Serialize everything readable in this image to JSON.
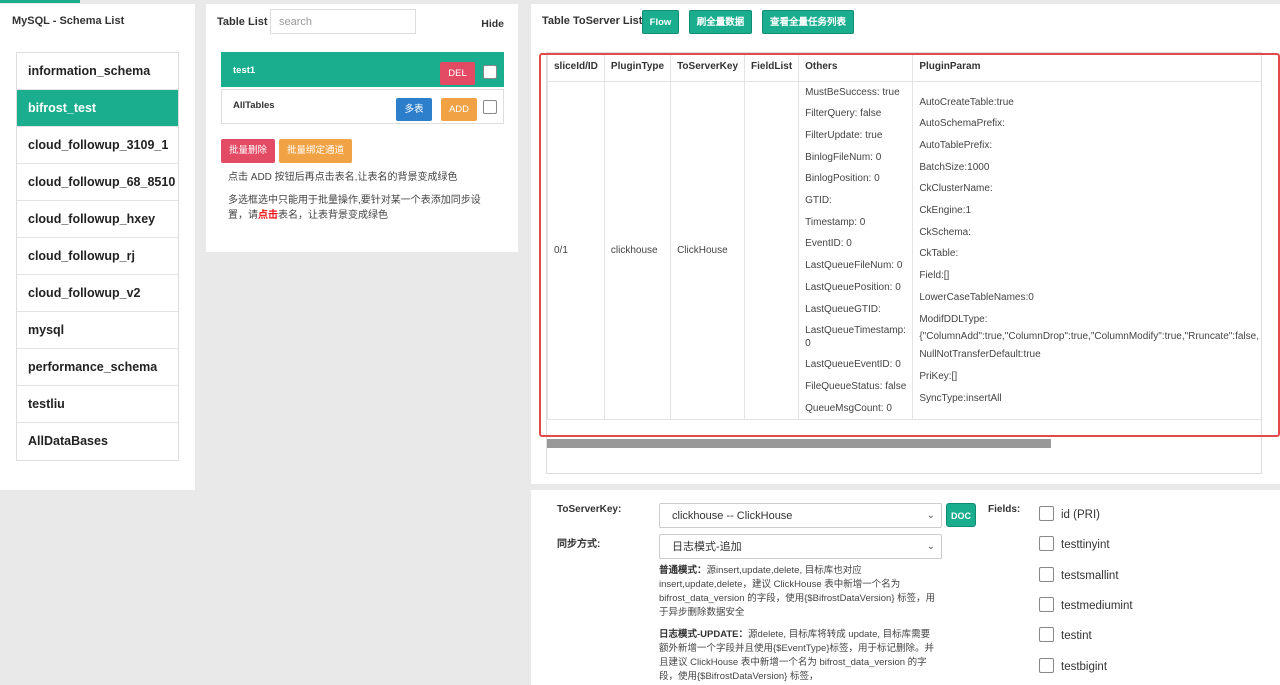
{
  "schema_panel": {
    "title": "MySQL - Schema List",
    "items": [
      "information_schema",
      "bifrost_test",
      "cloud_followup_3109_1",
      "cloud_followup_68_8510",
      "cloud_followup_hxey",
      "cloud_followup_rj",
      "cloud_followup_v2",
      "mysql",
      "performance_schema",
      "testliu",
      "AllDataBases"
    ],
    "active_index": 1
  },
  "table_panel": {
    "title": "Table List",
    "search_placeholder": "search",
    "hide_label": "Hide",
    "rows": [
      {
        "name": "test1",
        "del_label": "DEL"
      },
      {
        "name": "AllTables",
        "multi_label": "多表",
        "add_label": "ADD"
      }
    ],
    "batch_delete_label": "批量删除",
    "batch_bind_label": "批量绑定通道",
    "help_1": "点击 ADD 按钮后再点击表名,让表名的背景变成绿色",
    "help_2a": "多选框选中只能用于批量操作,要针对某一个表添加同步设置，请",
    "help_2b": "点击",
    "help_2c": "表名，让表背景变成绿色"
  },
  "server_panel": {
    "title": "Table ToServer List",
    "flow_label": "Flow",
    "refresh_label": "刷全量数据",
    "view_tasks_label": "查看全量任务列表",
    "columns": [
      "sliceId/ID",
      "PluginType",
      "ToServerKey",
      "FieldList",
      "Others",
      "PluginParam"
    ],
    "row": {
      "slice": "0/1",
      "plugin_type": "clickhouse",
      "to_server_key": "ClickHouse",
      "field_list": "",
      "others": [
        "MustBeSuccess: true",
        "FilterQuery: false",
        "FilterUpdate: true",
        "BinlogFileNum: 0",
        "BinlogPosition: 0",
        "GTID:",
        "Timestamp: 0",
        "EventID: 0",
        "LastQueueFileNum: 0",
        "LastQueuePosition: 0",
        "LastQueueGTID:",
        "LastQueueTimestamp: 0",
        "LastQueueEventID: 0",
        "FileQueueStatus: false",
        "QueueMsgCount: 0"
      ],
      "params": [
        "AutoCreateTable:true",
        "AutoSchemaPrefix:",
        "AutoTablePrefix:",
        "BatchSize:1000",
        "CkClusterName:",
        "CkEngine:1",
        "CkSchema:",
        "CkTable:",
        "Field:[]",
        "LowerCaseTableNames:0",
        "ModifDDLType:",
        "{\"ColumnAdd\":true,\"ColumnDrop\":true,\"ColumnModify\":true,\"Rruncate\":false,",
        "NullNotTransferDefault:true",
        "PriKey:[]",
        "SyncType:insertAll"
      ]
    }
  },
  "form": {
    "to_server_key_label": "ToServerKey:",
    "to_server_key_value": "clickhouse -- ClickHouse",
    "doc_label": "DOC",
    "sync_mode_label": "同步方式:",
    "sync_mode_value": "日志模式-追加",
    "normal_title": "普通模式：",
    "normal_desc": "源insert,update,delete, 目标库也对应insert,update,delete，建议 ClickHouse 表中新增一个名为 bifrost_data_version 的字段，使用{$BifrostDataVersion} 标签，用于异步删除数据安全",
    "log_title": "日志模式-UPDATE：",
    "log_desc": "源delete, 目标库将转成 update, 目标库需要额外新增一个字段并且使用{$EventType}标签，用于标记删除。并且建议 ClickHouse 表中新增一个名为 bifrost_data_version 的字段，使用{$BifrostDataVersion} 标签，",
    "fields_label": "Fields:",
    "fields": [
      "id (PRI)",
      "testtinyint",
      "testsmallint",
      "testmediumint",
      "testint",
      "testbigint"
    ]
  }
}
